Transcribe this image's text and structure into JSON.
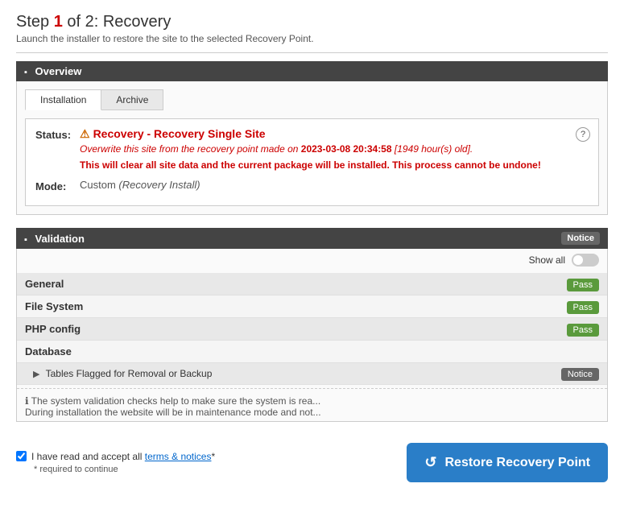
{
  "page": {
    "title_prefix": "Step ",
    "step_num": "1",
    "title_suffix": " of 2: Recovery",
    "subtitle": "Launch the installer to restore the site to the selected Recovery Point."
  },
  "overview": {
    "section_label": "Overview",
    "tabs": [
      {
        "id": "installation",
        "label": "Installation",
        "active": true
      },
      {
        "id": "archive",
        "label": "Archive",
        "active": false
      }
    ],
    "status": {
      "label": "Status:",
      "icon": "⚠",
      "title": "Recovery - Recovery Single Site",
      "desc_prefix": "Overwrite this site from the recovery point made on ",
      "desc_date": "2023-03-08 20:34:58",
      "desc_suffix": " [1949 hour(s) old].",
      "warning_text": "This will clear all site data and the current package will be installed. This process cannot be undone!",
      "help_icon": "?"
    },
    "mode": {
      "label": "Mode:",
      "value": "Custom ",
      "value_italic": "(Recovery Install)"
    }
  },
  "validation": {
    "section_label": "Validation",
    "notice_badge": "Notice",
    "show_all_label": "Show all",
    "rows": [
      {
        "label": "General",
        "badge": "Pass",
        "badge_type": "pass"
      },
      {
        "label": "File System",
        "badge": "Pass",
        "badge_type": "pass"
      },
      {
        "label": "PHP config",
        "badge": "Pass",
        "badge_type": "pass"
      },
      {
        "label": "Database",
        "badge": "",
        "badge_type": ""
      }
    ],
    "sub_row_label": "Tables Flagged for Removal or Backup",
    "sub_row_badge": "Notice",
    "info_line1": "ℹ The system validation checks help to make sure the system is rea...",
    "info_line2": "During installation the website will be in maintenance mode and not..."
  },
  "footer": {
    "checkbox_label": "I have read and accept all ",
    "checkbox_link": "terms & notices",
    "checkbox_suffix": "*",
    "required_note": "* required to continue",
    "restore_button_label": "Restore Recovery Point",
    "restore_icon": "↺"
  }
}
